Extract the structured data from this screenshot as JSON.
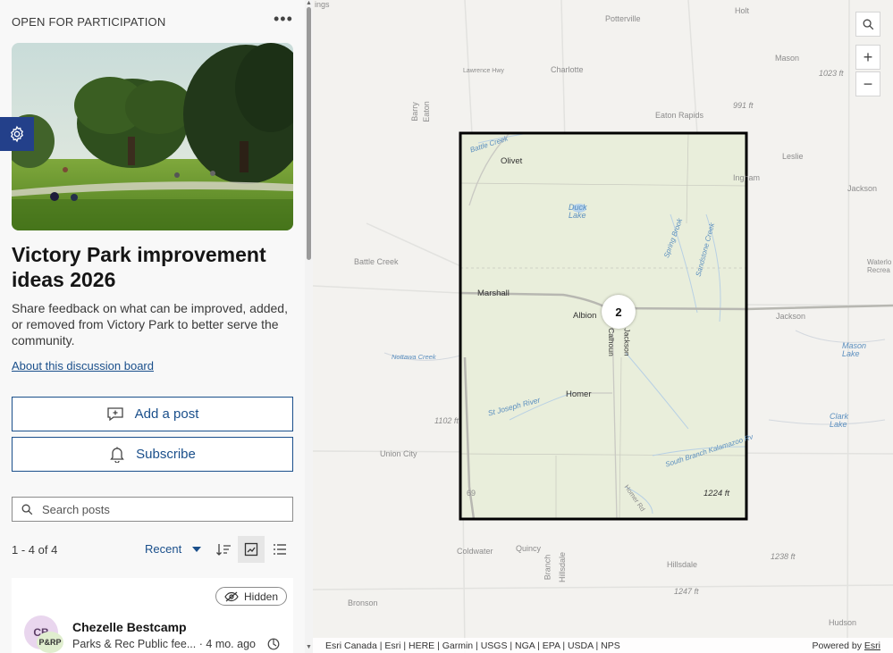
{
  "panel": {
    "status": "OPEN FOR PARTICIPATION",
    "title": "Victory Park improvement ideas 2026",
    "description": "Share feedback on what can be improved, added, or removed from Victory Park to better serve the community.",
    "about_link": "About this discussion board",
    "add_post_label": "Add a post",
    "subscribe_label": "Subscribe",
    "search_placeholder": "Search posts",
    "count": "1 - 4 of 4",
    "sort_label": "Recent",
    "post": {
      "hidden_label": "Hidden",
      "avatar_initials": "CB",
      "avatar_badge": "P&RP",
      "author": "Chezelle Bestcamp",
      "group": "Parks & Rec Public fee...",
      "time": "4 mo. ago"
    }
  },
  "map": {
    "cluster_count": "2",
    "attribution": "Esri Canada | Esri | HERE | Garmin | USGS | NGA | EPA | USDA | NPS",
    "powered_by": "Powered by",
    "powered_by_link": "Esri",
    "labels": {
      "potterville": "Potterville",
      "holt": "Holt",
      "charlotte": "Charlotte",
      "lawrence_hwy": "Lawrence Hwy",
      "mason": "Mason",
      "ft1023": "1023 ft",
      "ft991": "991 ft",
      "eaton_rapids": "Eaton Rapids",
      "barry": "Barry",
      "eaton": "Eaton",
      "battle_creek_road": "Battle Creek",
      "olivet": "Olivet",
      "leslie": "Leslie",
      "ingham": "Ingham",
      "jackson_county": "Jackson",
      "duck_lake": "Duck Lake",
      "spring_brook": "Spring Brook",
      "sandstone_creek": "Sandstone Creek",
      "battle_creek_city": "Battle Creek",
      "waterloo": "Waterlo Recrea",
      "marshall": "Marshall",
      "albion": "Albion",
      "jackson_label": "Jackson",
      "calhoun": "Calhoun",
      "jackson_city": "Jackson",
      "nottawa_creek": "Nottawa Creek",
      "mason_lake": "Mason Lake",
      "homer": "Homer",
      "st_joseph": "St Joseph River",
      "ft1102": "1102 ft",
      "clark_lake": "Clark Lake",
      "south_branch": "South Branch Kalamazoo Rv",
      "union_city": "Union City",
      "i69": "69",
      "homer_rd": "Homer Rd",
      "ft1224": "1224 ft",
      "coldwater": "Coldwater",
      "quincy": "Quincy",
      "branch": "Branch",
      "hillsdale_county": "Hillsdale",
      "ft1238": "1238 ft",
      "hillsdale": "Hillsdale",
      "ft1247": "1247 ft",
      "bronson": "Bronson",
      "hudson": "Hudson",
      "wings": "ings"
    }
  },
  "colors": {
    "accent": "#1a4f8b",
    "gear_bg": "#23408a",
    "extent_border": "#000000"
  },
  "icons": [
    "more-icon",
    "gear-icon",
    "add-post-icon",
    "bell-icon",
    "search-icon",
    "sort-direction-icon",
    "grid-view-icon",
    "list-view-icon",
    "hidden-eye-icon",
    "globe-icon",
    "zoom-in-icon",
    "zoom-out-icon",
    "map-search-icon"
  ]
}
